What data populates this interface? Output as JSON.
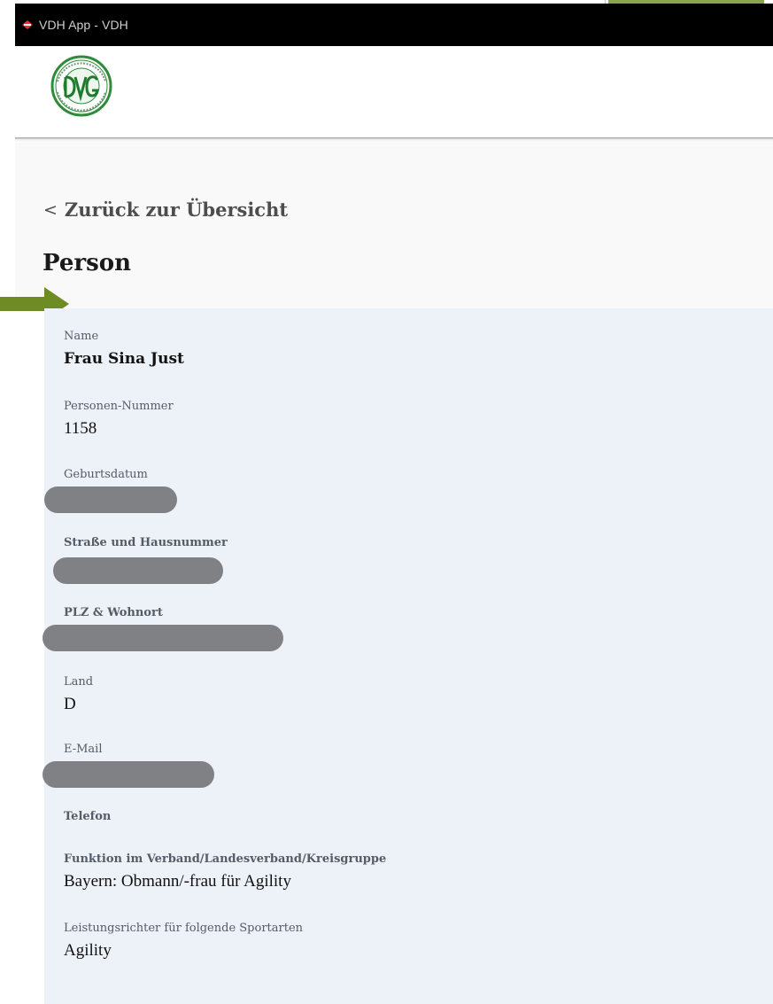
{
  "window": {
    "title": "VDH App - VDH"
  },
  "header": {
    "logo_alt": "DVG"
  },
  "nav": {
    "back_label": "Zurück zur Übersicht"
  },
  "page": {
    "title": "Person"
  },
  "person": {
    "name_label": "Name",
    "name_value": "Frau Sina Just",
    "number_label": "Personen-Nummer",
    "number_value": "1158",
    "birthdate_label": "Geburtsdatum",
    "street_label": "Straße und Hausnummer",
    "city_label": "PLZ & Wohnort",
    "country_label": "Land",
    "country_value": "D",
    "email_label": "E-Mail",
    "phone_label": "Telefon",
    "function_label": "Funktion im Verband/Landesverband/Kreisgruppe",
    "function_value": "Bayern: Obmann/-frau für Agility",
    "judge_label": "Leistungsrichter für folgende Sportarten",
    "judge_value": "Agility"
  },
  "colors": {
    "accent_green": "#6e8b24",
    "panel_bg": "#edf1f8",
    "redaction": "#808184",
    "titlebar_bg": "#000000"
  }
}
